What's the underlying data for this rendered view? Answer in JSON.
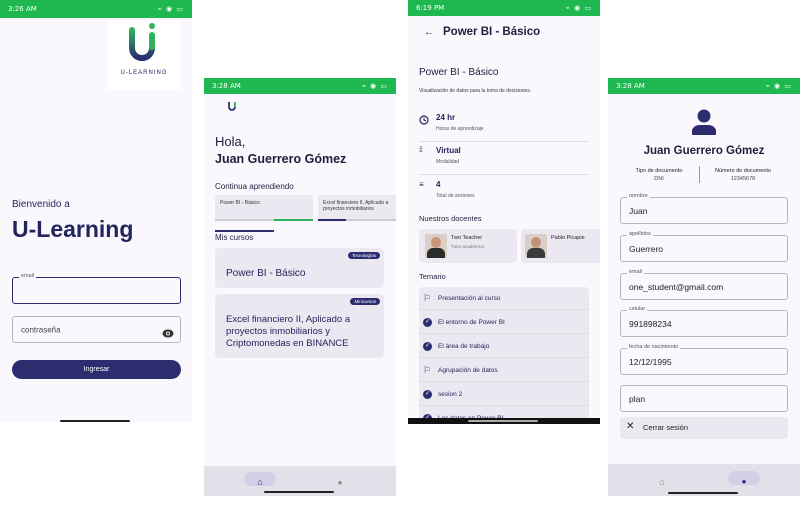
{
  "screen1": {
    "status_time": "3:26 AM",
    "status_icons_right": "⌁ ◉ ▭",
    "logo_text": "U-LEARNING",
    "welcome": "Bienvenido a",
    "app_name": "U-Learning",
    "email_label": "email",
    "password_placeholder": "contraseña",
    "login_button": "Ingresar"
  },
  "screen2": {
    "status_time": "3:28 AM",
    "status_icons_right": "⌁ ◉ ▭",
    "greeting": "Hola,",
    "user_name": "Juan Guerrero Gómez",
    "continue_title": "Continua aprendiendo",
    "continue_cards": [
      {
        "label": "Power BI - Básico",
        "progress": 1.0
      },
      {
        "label": "Excel financiero II, Aplicado a proyectos inmobiliarios",
        "progress": 0.35
      }
    ],
    "my_courses_title": "Mis cursos",
    "courses": [
      {
        "badge": "Tecnologías",
        "title": "Power BI - Básico"
      },
      {
        "badge": "Minicursos",
        "title": "Excel financiero II, Aplicado a proyectos inmobiliarios y Criptomonedas en BINANCE"
      }
    ]
  },
  "screen3": {
    "status_time": "6:19 PM",
    "status_icons_right": "⌁ ◉ ▭",
    "header_title": "Power BI - Básico",
    "course_title": "Power BI - Básico",
    "description": "Visualización de datos para la toma de decisiones.",
    "info": [
      {
        "icon": "clock-icon",
        "value": "24 hr",
        "label": "Horas de aprendizaje"
      },
      {
        "icon": "dots-grid-icon",
        "value": "Virtual",
        "label": "Modalidad"
      },
      {
        "icon": "list-icon",
        "value": "4",
        "label": "Total de sesiones"
      }
    ],
    "teachers_title": "Nuestros docentes",
    "teachers": [
      {
        "name": "Two Teacher",
        "role": "Tutor académico"
      },
      {
        "name": "Pablo Picapie",
        "role": ""
      }
    ],
    "syllabus_title": "Temario",
    "syllabus": [
      {
        "type": "flag",
        "label": "Presentación al curso"
      },
      {
        "type": "check",
        "label": "El entorno de Power BI"
      },
      {
        "type": "check",
        "label": "El área de trabajo"
      },
      {
        "type": "flag",
        "label": "Agrupación de datos"
      },
      {
        "type": "check",
        "label": "sesion 2"
      },
      {
        "type": "check",
        "label": "Los datos en Power BI"
      }
    ]
  },
  "screen4": {
    "status_time": "3:28 AM",
    "status_icons_right": "⌁ ◉ ▭",
    "user_name": "Juan Guerrero Gómez",
    "doc_type_label": "Tipo de documento",
    "doc_type_value": "DNI",
    "doc_number_label": "Número de documento",
    "doc_number_value": "12345678",
    "fields": [
      {
        "label": "nombre",
        "value": "Juan"
      },
      {
        "label": "apellidos",
        "value": "Guerrero"
      },
      {
        "label": "email",
        "value": "one_student@gmail.com"
      },
      {
        "label": "celular",
        "value": "991898234"
      },
      {
        "label": "fecha de nacimiento",
        "value": "12/12/1995"
      },
      {
        "label": "",
        "value": "plan"
      }
    ],
    "logout": "Cerrar sesión"
  },
  "colors": {
    "status_green": "#1fb74f",
    "primary_navy": "#2b2d6e",
    "accent_green": "#2fb35a"
  }
}
